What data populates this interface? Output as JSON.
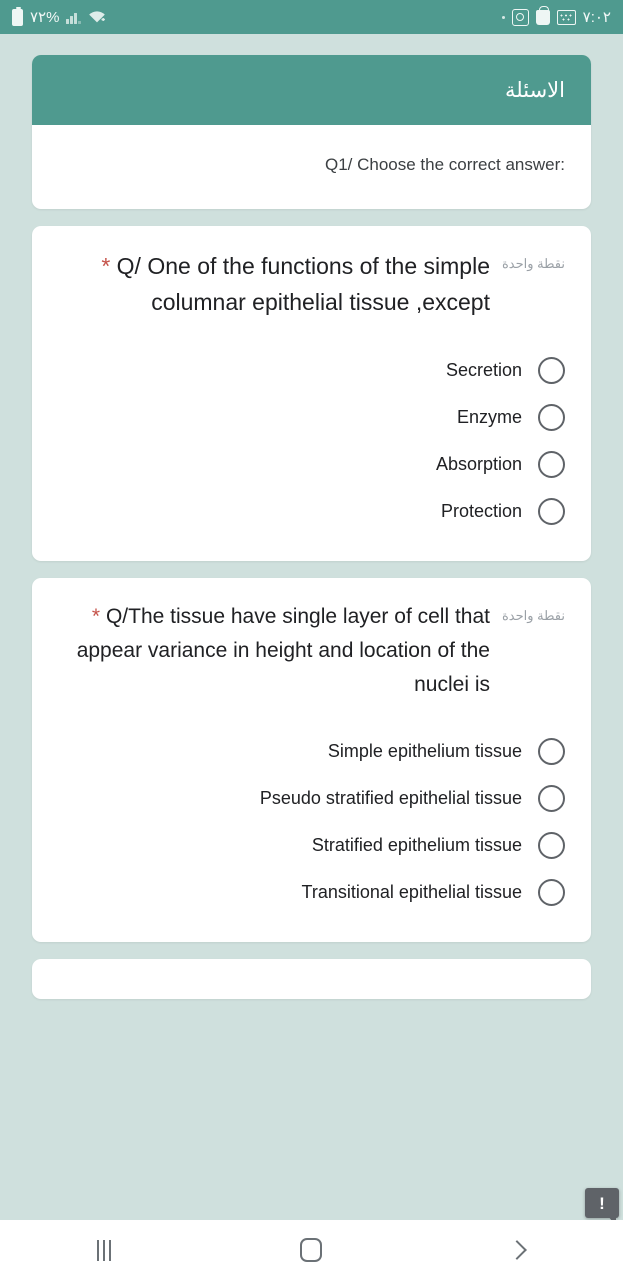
{
  "status_bar": {
    "battery_percent": "٧٢%",
    "time": "٧:٠٢",
    "icons": [
      "battery-icon",
      "signal-icon",
      "wifi-icon",
      "dot-icon",
      "circle-square-icon",
      "shopping-bag-icon",
      "keyboard-icon"
    ],
    "background_color": "#4f9a8f"
  },
  "theme": {
    "page_background": "#cfe0dd",
    "accent": "#4f9a8f",
    "card_background": "#ffffff",
    "required_star": "#c5534a",
    "radio_border": "#5f6368"
  },
  "form": {
    "header": {
      "title": "الاسئلة",
      "subtitle": "Q1/ Choose the correct answer:"
    },
    "questions": [
      {
        "points_label": "نقطة واحدة",
        "text": "Q/ One of the functions of the simple columnar epithelial tissue ,except",
        "required_marker": "*",
        "options": [
          {
            "label": "Secretion",
            "selected": false
          },
          {
            "label": "Enzyme",
            "selected": false
          },
          {
            "label": "Absorption",
            "selected": false
          },
          {
            "label": "Protection",
            "selected": false
          }
        ]
      },
      {
        "points_label": "نقطة واحدة",
        "text": "Q/The tissue have single layer of cell that appear variance in height and location of the nuclei is",
        "required_marker": "*",
        "options": [
          {
            "label": "Simple epithelium tissue",
            "selected": false
          },
          {
            "label": "Pseudo stratified epithelial tissue",
            "selected": false
          },
          {
            "label": "Stratified epithelium tissue",
            "selected": false
          },
          {
            "label": "Transitional epithelial tissue",
            "selected": false
          }
        ]
      }
    ]
  },
  "feedback_badge": {
    "glyph": "!",
    "name": "report-problem-icon"
  },
  "nav_bar": {
    "recents_label": "recents-icon",
    "home_label": "home-icon",
    "back_label": "back-icon"
  }
}
